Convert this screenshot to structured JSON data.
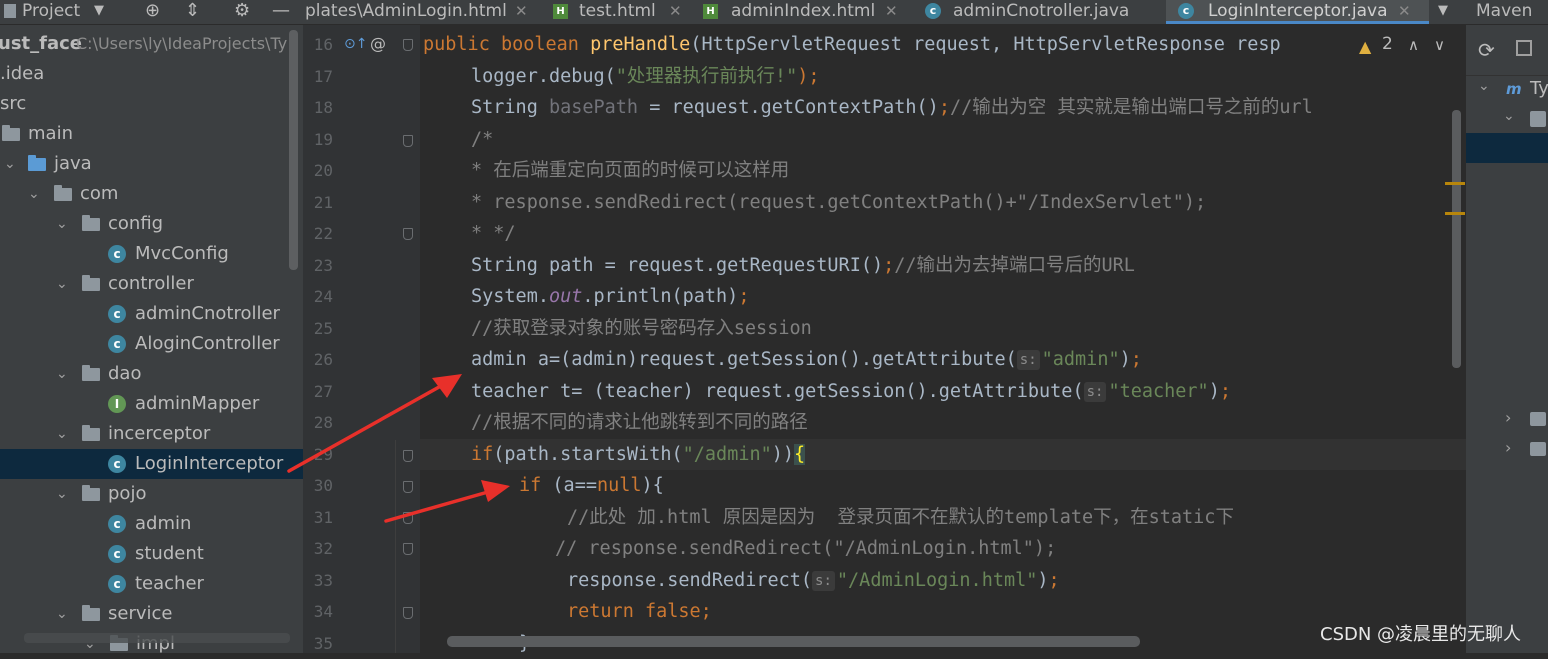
{
  "topbar": {
    "project_label": "Project",
    "tabs": [
      {
        "label": "plates\\AdminLogin.html"
      },
      {
        "label": "test.html"
      },
      {
        "label": "adminIndex.html"
      },
      {
        "label": "adminCnotroller.java"
      },
      {
        "label": "LoginInterceptor.java"
      }
    ],
    "maven_label": "Maven"
  },
  "project_tree": {
    "root_name": "ust_face",
    "root_path": "C:\\Users\\ly\\IdeaProjects\\Ty",
    "items": [
      {
        "label": ".idea"
      },
      {
        "label": "src"
      },
      {
        "label": "main"
      },
      {
        "label": "java"
      },
      {
        "label": "com"
      },
      {
        "label": "config"
      },
      {
        "label": "MvcConfig"
      },
      {
        "label": "controller"
      },
      {
        "label": "adminCnotroller"
      },
      {
        "label": "AloginController"
      },
      {
        "label": "dao"
      },
      {
        "label": "adminMapper"
      },
      {
        "label": "incerceptor"
      },
      {
        "label": "LoginInterceptor"
      },
      {
        "label": "pojo"
      },
      {
        "label": "admin"
      },
      {
        "label": "student"
      },
      {
        "label": "teacher"
      },
      {
        "label": "service"
      },
      {
        "label": "impl"
      }
    ]
  },
  "editor": {
    "line_numbers": [
      "16",
      "17",
      "18",
      "19",
      "20",
      "21",
      "22",
      "23",
      "24",
      "25",
      "26",
      "27",
      "28",
      "29",
      "30",
      "31",
      "32",
      "33",
      "34",
      "35"
    ],
    "warning_count": "2",
    "hint_s": "s:",
    "l16": {
      "kw": "public boolean ",
      "fn": "preHandle",
      "rest": "(HttpServletRequest request, HttpServletResponse resp"
    },
    "l17": {
      "a": "logger.debug(",
      "s": "\"处理器执行前执行!\"",
      "b": ");"
    },
    "l18": {
      "a": "String ",
      "u": "basePath",
      "b": " = request.getContextPath()",
      "c": ";",
      "cm": "//输出为空 其实就是输出端口号之前的url"
    },
    "l19": "/*",
    "l20": "* 在后端重定向页面的时候可以这样用",
    "l21": "* response.sendRedirect(request.getContextPath()+\"/IndexServlet\");",
    "l22": "* */",
    "l23": {
      "a": "String path = request.getRequestURI()",
      "c": ";",
      "cm": "//输出为去掉端口号后的URL"
    },
    "l24": {
      "a": "System.",
      "st": "out",
      "b": ".println(path)",
      "c": ";"
    },
    "l25": "//获取登录对象的账号密码存入session",
    "l26": {
      "a": "admin a=(admin)request.getSession().getAttribute(",
      "s": "\"admin\"",
      "b": ")",
      "c": ";"
    },
    "l27": {
      "a": "teacher t= (teacher) request.getSession().getAttribute(",
      "s": "\"teacher\"",
      "b": ")",
      "c": ";"
    },
    "l28": "//根据不同的请求让他跳转到不同的路径",
    "l29": {
      "kw": "if",
      "a": "(path.startsWith(",
      "s": "\"/admin\"",
      "b": "))",
      "br": "{"
    },
    "l30": {
      "kw": "if ",
      "a": "(a==",
      "n": "null",
      "b": "){"
    },
    "l31": "//此处 加.html 原因是因为  登录页面不在默认的template下，在static下",
    "l32": "// response.sendRedirect(\"/AdminLogin.html\");",
    "l33": {
      "a": "response.sendRedirect(",
      "s": "\"/AdminLogin.html\"",
      "b": ")",
      "c": ";"
    },
    "l34": {
      "kw": "return false",
      "c": ";"
    },
    "l35": "}"
  },
  "right_panel": {
    "ty_label": "Ty"
  },
  "watermark": "CSDN @凌晨里的无聊人",
  "colors": {
    "keyword": "#cc7832",
    "string": "#6a8759",
    "comment": "#808080",
    "method": "#ffc66d",
    "arrow": "#e8302a"
  }
}
